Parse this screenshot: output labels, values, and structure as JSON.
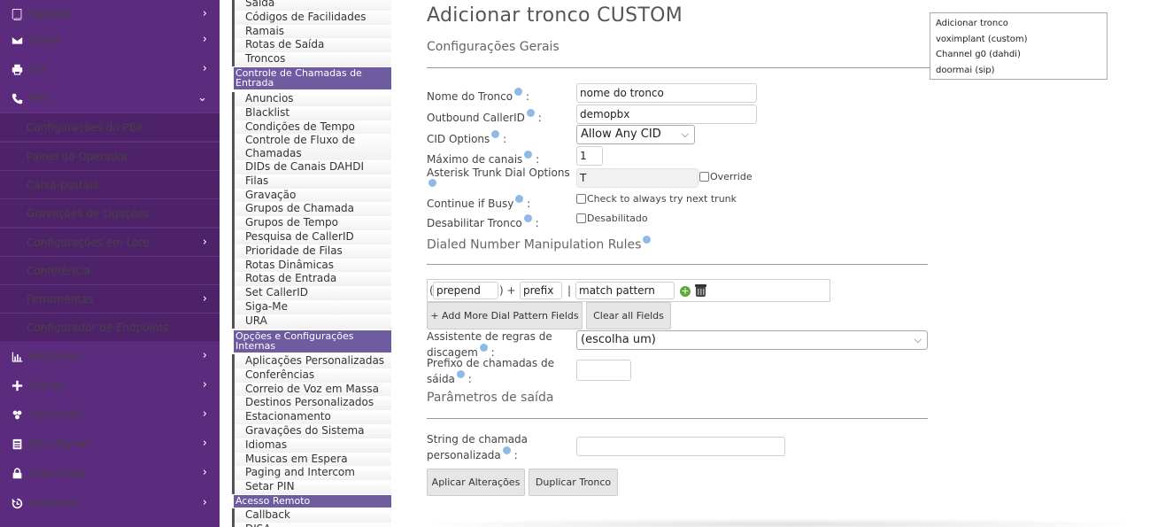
{
  "sidebar": {
    "items": [
      {
        "label": "Agenda",
        "icon": "book-icon",
        "chevron": "›"
      },
      {
        "label": "Email",
        "icon": "envelope-icon",
        "chevron": "›"
      },
      {
        "label": "Fax",
        "icon": "printer-icon",
        "chevron": "›"
      },
      {
        "label": "PBX",
        "icon": "phone-icon",
        "chevron": "⌄"
      },
      {
        "label": "Configurações do PBX"
      },
      {
        "label": "Painel do Operador"
      },
      {
        "label": "Caixa-postais"
      },
      {
        "label": "Gravações de Ligações"
      },
      {
        "label": "Configurações em Lote",
        "chevron": "›"
      },
      {
        "label": "Conferência"
      },
      {
        "label": "Ferramentas",
        "chevron": "›"
      },
      {
        "label": "Configurador de Endpoints"
      },
      {
        "label": "Relatórios",
        "icon": "bar-chart-icon",
        "chevron": "›"
      },
      {
        "label": "Extras",
        "icon": "plus-icon",
        "chevron": "›"
      },
      {
        "label": "Adicionais",
        "icon": "puzzle-icon",
        "chevron": "›"
      },
      {
        "label": "Meu Ramal",
        "icon": "contact-card-icon",
        "chevron": "›"
      },
      {
        "label": "Segurança",
        "icon": "lock-icon",
        "chevron": "›"
      },
      {
        "label": "Histórico",
        "icon": "history-icon",
        "chevron": "›"
      }
    ]
  },
  "modules": {
    "group1": [
      "Saída",
      "Códigos de Facilidades",
      "Ramais",
      "Rotas de Saída",
      "Troncos"
    ],
    "header1": "Controle de Chamadas de Entrada",
    "group2": [
      "Anuncios",
      "Blacklist",
      "Condições de Tempo",
      "Controle de Fluxo de Chamadas",
      "DIDs de Canais DAHDI",
      "Filas",
      "Gravação",
      "Grupos de Chamada",
      "Grupos de Tempo",
      "Pesquisa de CallerID",
      "Prioridade de Filas",
      "Rotas Dinâmicas",
      "Rotas de Entrada",
      "Set CallerID",
      "Siga-Me",
      "URA"
    ],
    "header2": "Opções e Configurações Internas",
    "group3": [
      "Aplicações Personalizadas",
      "Conferências",
      "Correio de Voz em Massa",
      "Destinos Personalizados",
      "Estacionamento",
      "Gravações do Sistema",
      "Idiomas",
      "Musicas em Espera",
      "Paging and Intercom",
      "Setar PIN"
    ],
    "header3": "Acesso Remoto",
    "group4": [
      "Callback",
      "DISA"
    ]
  },
  "form": {
    "title": "Adicionar tronco CUSTOM",
    "section_general": "Configurações Gerais",
    "trunk_name_label": "Nome do Tronco",
    "trunk_name_value": "nome do tronco",
    "outbound_cid_label": "Outbound CallerID",
    "outbound_cid_value": "demopbx",
    "cid_options_label": "CID Options",
    "cid_options_value": "Allow Any CID",
    "max_channels_label": "Máximo de canais",
    "max_channels_value": "1",
    "dial_options_label": "Asterisk Trunk Dial Options",
    "dial_options_value": "T",
    "override_label": "Override",
    "continue_busy_label": "Continue if Busy",
    "continue_busy_check": "Check to always try next trunk",
    "disable_trunk_label": "Desabilitar Tronco",
    "disable_trunk_check": "Desabilitado",
    "section_rules": "Dialed Number Manipulation Rules",
    "pattern_open": "(",
    "prepend_value": "prepend",
    "pattern_close_plus": ") +",
    "prefix_value": "prefix",
    "pattern_sep": "|",
    "match_value": "match pattern",
    "add_more_button": "+ Add More Dial Pattern Fields",
    "clear_button": "Clear all Fields",
    "wizard_label": "Assistente de regras de discagem",
    "wizard_value": "(escolha um)",
    "outbound_prefix_label": "Prefixo de chamadas de sáida",
    "section_output": "Parâmetros de saída",
    "custom_dial_label": "String de chamada personalizada",
    "apply_button": "Aplicar Alterações",
    "duplicate_button": "Duplicar Tronco",
    "colon": ":"
  },
  "right_nav": [
    "Adicionar tronco",
    "voximplant (custom)",
    "Channel g0 (dahdi)",
    "doormai (sip)"
  ],
  "colors": {
    "sidebar_bg": "#5b2c7d",
    "module_header": "#6e5ba0",
    "help_icon": "#8fb9e6"
  }
}
